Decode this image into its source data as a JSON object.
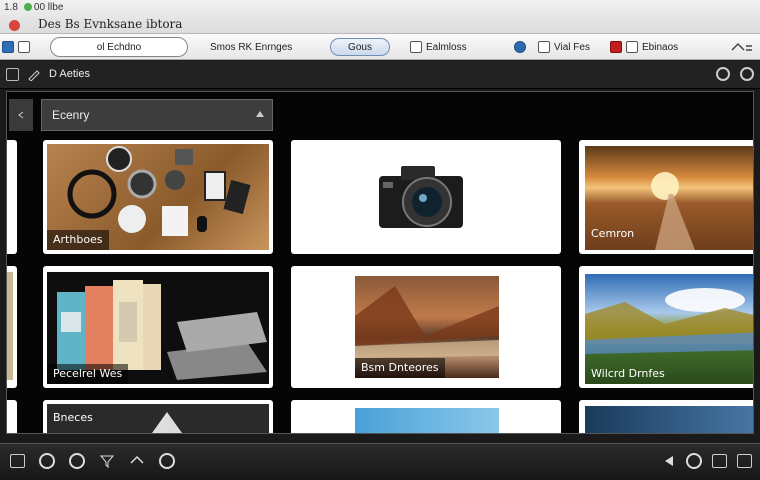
{
  "window": {
    "meta": "1.8",
    "meta_label": "00 llbe",
    "title": "Des Bs Evnksane ibtora"
  },
  "toolbar": {
    "search_value": "ol Echdno",
    "item1": "Smos RK Enrnges",
    "go_label": "Gous",
    "item2": "Ealmloss",
    "item3": "Vial Fes",
    "item4": "Ebinaos"
  },
  "panel": {
    "title": "D Aeties"
  },
  "category": {
    "label": "Ecenry"
  },
  "tiles": [
    {
      "label": "Arthboes"
    },
    {
      "label": ""
    },
    {
      "label": "Cemron"
    },
    {
      "label": "Pecelrel Wes"
    },
    {
      "label": "Bsm Dnteores"
    },
    {
      "label": "Wilcrd Drnfes"
    },
    {
      "label": "Bneces"
    },
    {
      "label": ""
    },
    {
      "label": ""
    }
  ]
}
